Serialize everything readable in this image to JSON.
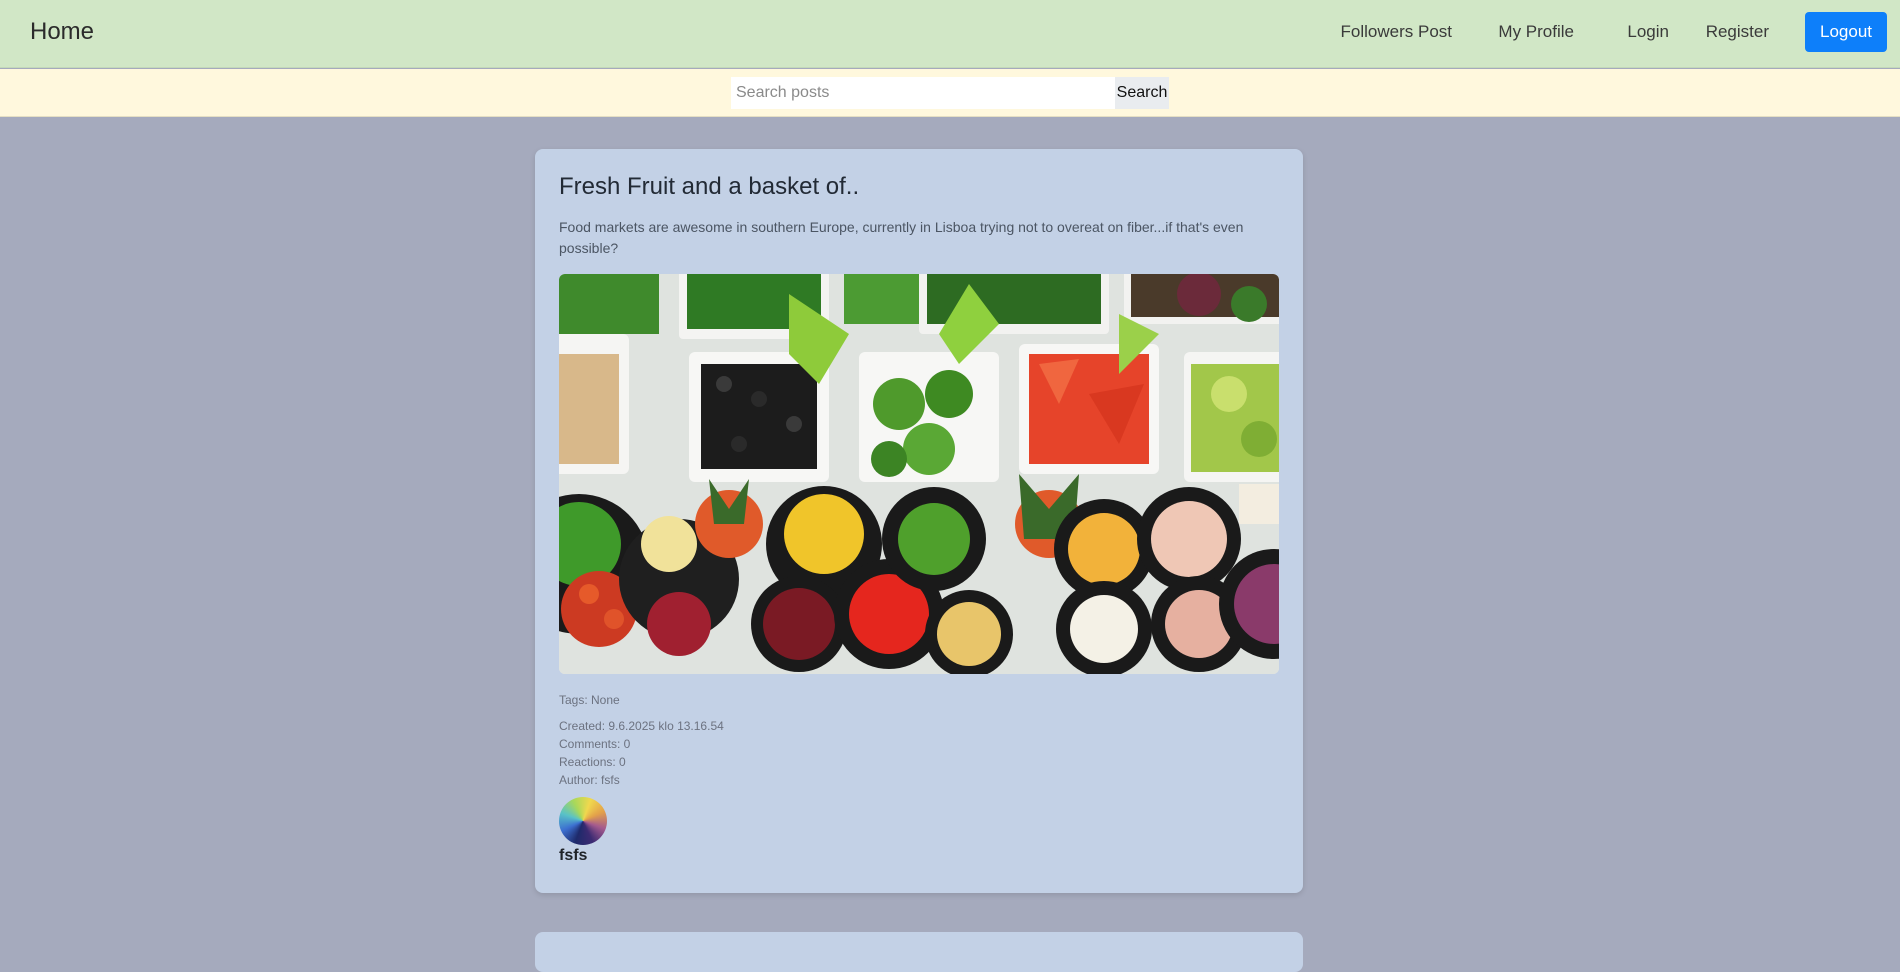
{
  "navbar": {
    "brand": "Home",
    "links": {
      "followers": "Followers Post",
      "profile": "My Profile",
      "login": "Login",
      "register": "Register"
    },
    "logout": "Logout"
  },
  "search": {
    "placeholder": "Search posts",
    "value": "",
    "button": "Search"
  },
  "post": {
    "title": "Fresh Fruit and a basket of..",
    "body": "Food markets are awesome in southern Europe, currently in Lisboa trying not to overeat on fiber...if that's even possible?",
    "tags": "Tags: None",
    "created": "Created: 9.6.2025 klo 13.16.54",
    "comments": "Comments: 0",
    "reactions": "Reactions: 0",
    "author": "Author: fsfs",
    "avatar_name": "fsfs"
  },
  "colors": {
    "navbar_bg": "#d1e7c6",
    "searchbar_bg": "#fff8dd",
    "page_bg": "#a5aabd",
    "card_bg": "#c3d1e6",
    "logout_bg": "#0d7ffa"
  }
}
